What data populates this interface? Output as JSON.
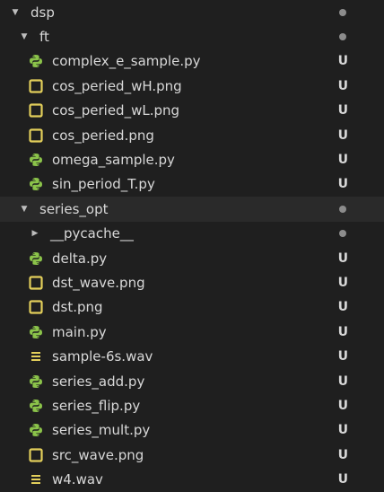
{
  "tree": {
    "root": {
      "label": "dsp",
      "expanded": true,
      "status": "dot"
    },
    "ft": {
      "label": "ft",
      "expanded": true,
      "status": "dot",
      "files": [
        {
          "label": "complex_e_sample.py",
          "icon": "python-icon",
          "status": "U"
        },
        {
          "label": "cos_peried_wH.png",
          "icon": "image-icon",
          "status": "U"
        },
        {
          "label": "cos_peried_wL.png",
          "icon": "image-icon",
          "status": "U"
        },
        {
          "label": "cos_peried.png",
          "icon": "image-icon",
          "status": "U"
        },
        {
          "label": "omega_sample.py",
          "icon": "python-icon",
          "status": "U"
        },
        {
          "label": "sin_period_T.py",
          "icon": "python-icon",
          "status": "U"
        }
      ]
    },
    "series_opt": {
      "label": "series_opt",
      "expanded": true,
      "status": "dot",
      "pycache": {
        "label": "__pycache__",
        "expanded": false,
        "status": "dot"
      },
      "files": [
        {
          "label": "delta.py",
          "icon": "python-icon",
          "status": "U"
        },
        {
          "label": "dst_wave.png",
          "icon": "image-icon",
          "status": "U"
        },
        {
          "label": "dst.png",
          "icon": "image-icon",
          "status": "U"
        },
        {
          "label": "main.py",
          "icon": "python-icon",
          "status": "U"
        },
        {
          "label": "sample-6s.wav",
          "icon": "audio-icon",
          "status": "U"
        },
        {
          "label": "series_add.py",
          "icon": "python-icon",
          "status": "U"
        },
        {
          "label": "series_flip.py",
          "icon": "python-icon",
          "status": "U"
        },
        {
          "label": "series_mult.py",
          "icon": "python-icon",
          "status": "U"
        },
        {
          "label": "src_wave.png",
          "icon": "image-icon",
          "status": "U"
        },
        {
          "label": "w4.wav",
          "icon": "audio-icon",
          "status": "U"
        }
      ]
    }
  },
  "colors": {
    "background": "#1f1f1f",
    "python": "#8bc34a",
    "image": "#e3cf5b",
    "audio": "#e3cf5b",
    "status": "#d7d7d7",
    "dot": "#8c8c8c"
  }
}
